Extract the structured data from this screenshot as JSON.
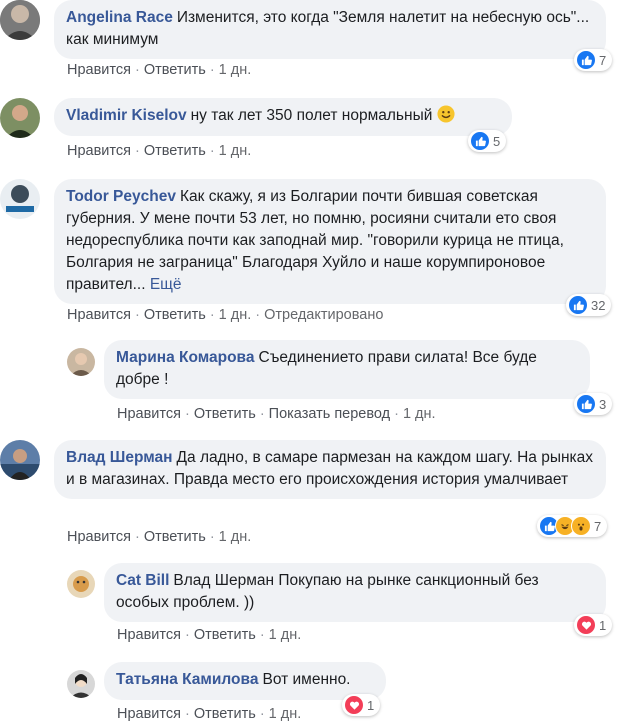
{
  "comments": [
    {
      "author": "Angelina Race",
      "text": "Изменится, это когда \"Земля налетит на небесную ось\"... как минимум",
      "actions": [
        "Нравится",
        "Ответить",
        "1 дн."
      ],
      "reaction_count": "7",
      "reactions": [
        "like-icon"
      ]
    },
    {
      "author": "Vladimir Kiselov",
      "text": "ну так лет 350 полет нормальный",
      "actions": [
        "Нравится",
        "Ответить",
        "1 дн."
      ],
      "reaction_count": "5",
      "reactions": [
        "like-icon"
      ]
    },
    {
      "author": "Todor Peychev",
      "text": "Как скажу, я из Болгарии почти бившая советская губерния. У мене почти 53 лет, но помню, росияни считали ето своя недореспублика почти как заподнай мир. \"говорили курица не птица, Болгария не заграница\" Благодаря Хуйло и наше корумпироновое правител...",
      "more": "Ещё",
      "actions": [
        "Нравится",
        "Ответить",
        "1 дн.",
        "Отредактировано"
      ],
      "reaction_count": "32",
      "reactions": [
        "like-icon"
      ]
    },
    {
      "author": "Марина Комарова",
      "text": "Съединението прави силата! Все буде добре !",
      "actions": [
        "Нравится",
        "Ответить",
        "Показать перевод",
        "1 дн."
      ],
      "reaction_count": "3",
      "reactions": [
        "like-icon"
      ]
    },
    {
      "author": "Влад Шерман",
      "text": "Да ладно, в самаре пармезан на каждом шагу. На рынках и в магазинах. Правда место его происхождения история умалчивает",
      "actions": [
        "Нравится",
        "Ответить",
        "1 дн."
      ],
      "reaction_count": "7",
      "reactions": [
        "like-icon",
        "haha-icon",
        "wow-icon"
      ]
    },
    {
      "author": "Cat Bill",
      "text": "Влад Шерман Покупаю на рынке санкционный без особых проблем. ))",
      "actions": [
        "Нравится",
        "Ответить",
        "1 дн."
      ],
      "reaction_count": "1",
      "reactions": [
        "heart-icon"
      ]
    },
    {
      "author": "Татьяна Камилова",
      "text": "Вот именно.",
      "actions": [
        "Нравится",
        "Ответить",
        "1 дн."
      ],
      "reaction_count": "1",
      "reactions": [
        "heart-icon"
      ]
    }
  ],
  "colors": {
    "author": "#385898",
    "bubble": "#f0f2f5",
    "like": "#1877f2",
    "heart": "#f33e58",
    "haha": "#f7b125"
  }
}
